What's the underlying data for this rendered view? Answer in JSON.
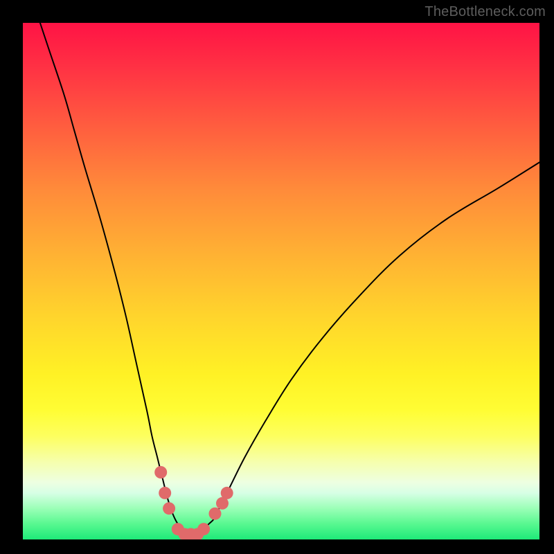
{
  "watermark": "TheBottleneck.com",
  "colors": {
    "curve_stroke": "#000000",
    "marker_fill": "#e06a6a",
    "marker_stroke": "#c94f4f",
    "gradient_top": "#ff1345",
    "gradient_bottom": "#1eea79",
    "background": "#000000"
  },
  "chart_data": {
    "type": "line",
    "title": "",
    "xlabel": "",
    "ylabel": "",
    "xlim": [
      0,
      100
    ],
    "ylim": [
      0,
      100
    ],
    "grid": false,
    "legend": false,
    "series": [
      {
        "name": "curve",
        "x": [
          3,
          5,
          8,
          10,
          12,
          15,
          18,
          20,
          22,
          24,
          25,
          26,
          27,
          28,
          29,
          30,
          31,
          32,
          33,
          34,
          35,
          36,
          37,
          38,
          40,
          43,
          47,
          52,
          58,
          65,
          73,
          82,
          92,
          100
        ],
        "y": [
          101,
          95,
          86,
          79,
          72,
          62,
          51,
          43,
          34,
          25,
          20,
          16,
          12,
          8,
          5,
          3,
          2,
          1,
          1,
          1,
          2,
          3,
          4,
          6,
          10,
          16,
          23,
          31,
          39,
          47,
          55,
          62,
          68,
          73
        ]
      }
    ],
    "markers": [
      {
        "x": 26.7,
        "y": 13
      },
      {
        "x": 27.5,
        "y": 9
      },
      {
        "x": 28.3,
        "y": 6
      },
      {
        "x": 30.0,
        "y": 2
      },
      {
        "x": 31.3,
        "y": 1
      },
      {
        "x": 32.5,
        "y": 1
      },
      {
        "x": 33.8,
        "y": 1
      },
      {
        "x": 35.0,
        "y": 2
      },
      {
        "x": 37.2,
        "y": 5
      },
      {
        "x": 38.6,
        "y": 7
      },
      {
        "x": 39.5,
        "y": 9
      }
    ]
  }
}
